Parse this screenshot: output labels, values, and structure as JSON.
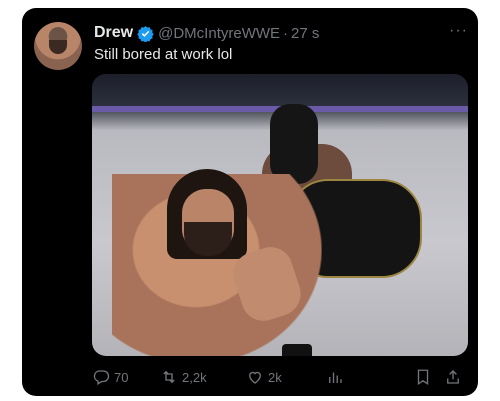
{
  "tweet": {
    "author_name": "Drew",
    "handle": "@DMcIntyreWWE",
    "separator": "·",
    "time": "27 s",
    "text": "Still bored at work lol",
    "more": "···"
  },
  "actions": {
    "replies": "70",
    "reposts": "2,2k",
    "likes": "2k"
  },
  "colors": {
    "background": "#000000",
    "text_primary": "#e7e9ea",
    "text_secondary": "#71767b",
    "verified": "#1d9bf0"
  },
  "icons": [
    "verified-badge-icon",
    "more-icon",
    "reply-icon",
    "repost-icon",
    "like-icon",
    "views-icon",
    "bookmark-icon",
    "share-icon"
  ]
}
